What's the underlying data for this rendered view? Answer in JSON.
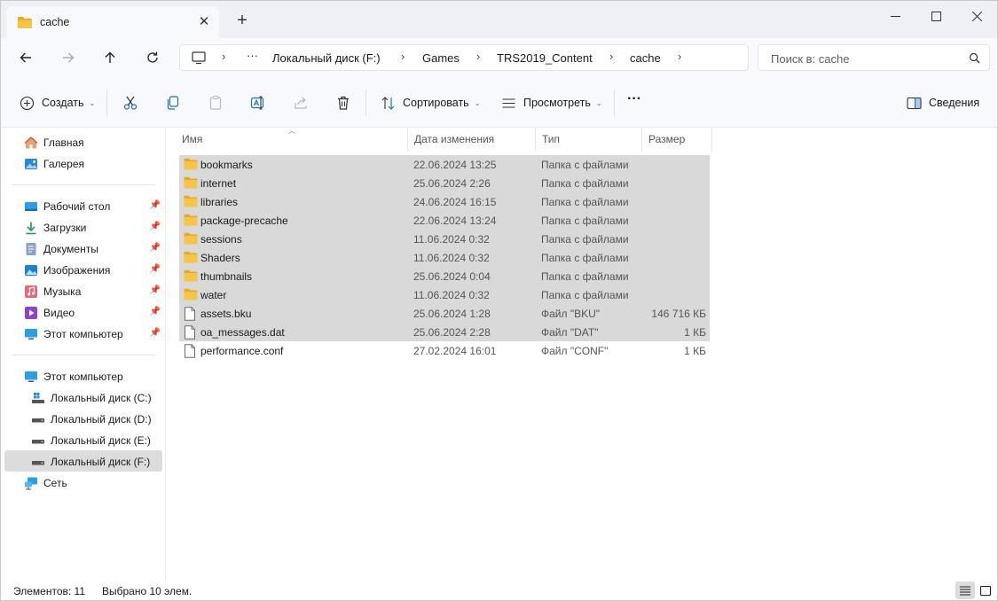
{
  "tab": {
    "title": "cache"
  },
  "breadcrumb": {
    "overflow": "···",
    "items": [
      "Локальный диск (F:)",
      "Games",
      "TRS2019_Content",
      "cache"
    ]
  },
  "search": {
    "placeholder": "Поиск в: cache"
  },
  "toolbar": {
    "create": "Создать",
    "sort": "Сортировать",
    "view": "Просмотреть",
    "more": "···",
    "details": "Сведения"
  },
  "sidebar": {
    "top": [
      "Главная",
      "Галерея"
    ],
    "quick": [
      "Рабочий стол",
      "Загрузки",
      "Документы",
      "Изображения",
      "Музыка",
      "Видео",
      "Этот компьютер"
    ],
    "pc": "Этот компьютер",
    "drives": [
      "Локальный диск (C:)",
      "Локальный диск (D:)",
      "Локальный диск (E:)",
      "Локальный диск (F:)"
    ],
    "network": "Сеть"
  },
  "columns": {
    "name": "Имя",
    "date": "Дата изменения",
    "type": "Тип",
    "size": "Размер"
  },
  "files": [
    {
      "name": "bookmarks",
      "date": "22.06.2024 13:25",
      "type": "Папка с файлами",
      "size": "",
      "kind": "folder",
      "selected": true
    },
    {
      "name": "internet",
      "date": "25.06.2024 2:26",
      "type": "Папка с файлами",
      "size": "",
      "kind": "folder",
      "selected": true
    },
    {
      "name": "libraries",
      "date": "24.06.2024 16:15",
      "type": "Папка с файлами",
      "size": "",
      "kind": "folder",
      "selected": true
    },
    {
      "name": "package-precache",
      "date": "22.06.2024 13:24",
      "type": "Папка с файлами",
      "size": "",
      "kind": "folder",
      "selected": true
    },
    {
      "name": "sessions",
      "date": "11.06.2024 0:32",
      "type": "Папка с файлами",
      "size": "",
      "kind": "folder",
      "selected": true
    },
    {
      "name": "Shaders",
      "date": "11.06.2024 0:32",
      "type": "Папка с файлами",
      "size": "",
      "kind": "folder",
      "selected": true
    },
    {
      "name": "thumbnails",
      "date": "25.06.2024 0:04",
      "type": "Папка с файлами",
      "size": "",
      "kind": "folder",
      "selected": true
    },
    {
      "name": "water",
      "date": "11.06.2024 0:32",
      "type": "Папка с файлами",
      "size": "",
      "kind": "folder",
      "selected": true
    },
    {
      "name": "assets.bku",
      "date": "25.06.2024 1:28",
      "type": "Файл \"BKU\"",
      "size": "146 716 КБ",
      "kind": "file",
      "selected": true
    },
    {
      "name": "oa_messages.dat",
      "date": "25.06.2024 2:28",
      "type": "Файл \"DAT\"",
      "size": "1 КБ",
      "kind": "file",
      "selected": true
    },
    {
      "name": "performance.conf",
      "date": "27.02.2024 16:01",
      "type": "Файл \"CONF\"",
      "size": "1 КБ",
      "kind": "file",
      "selected": false
    }
  ],
  "status": {
    "count": "Элементов: 11",
    "selected": "Выбрано 10 элем."
  },
  "colors": {
    "folder": "#f8c443",
    "folder_dark": "#e8a921",
    "selection": "#d9d9d9",
    "accent": "#0067c0"
  }
}
